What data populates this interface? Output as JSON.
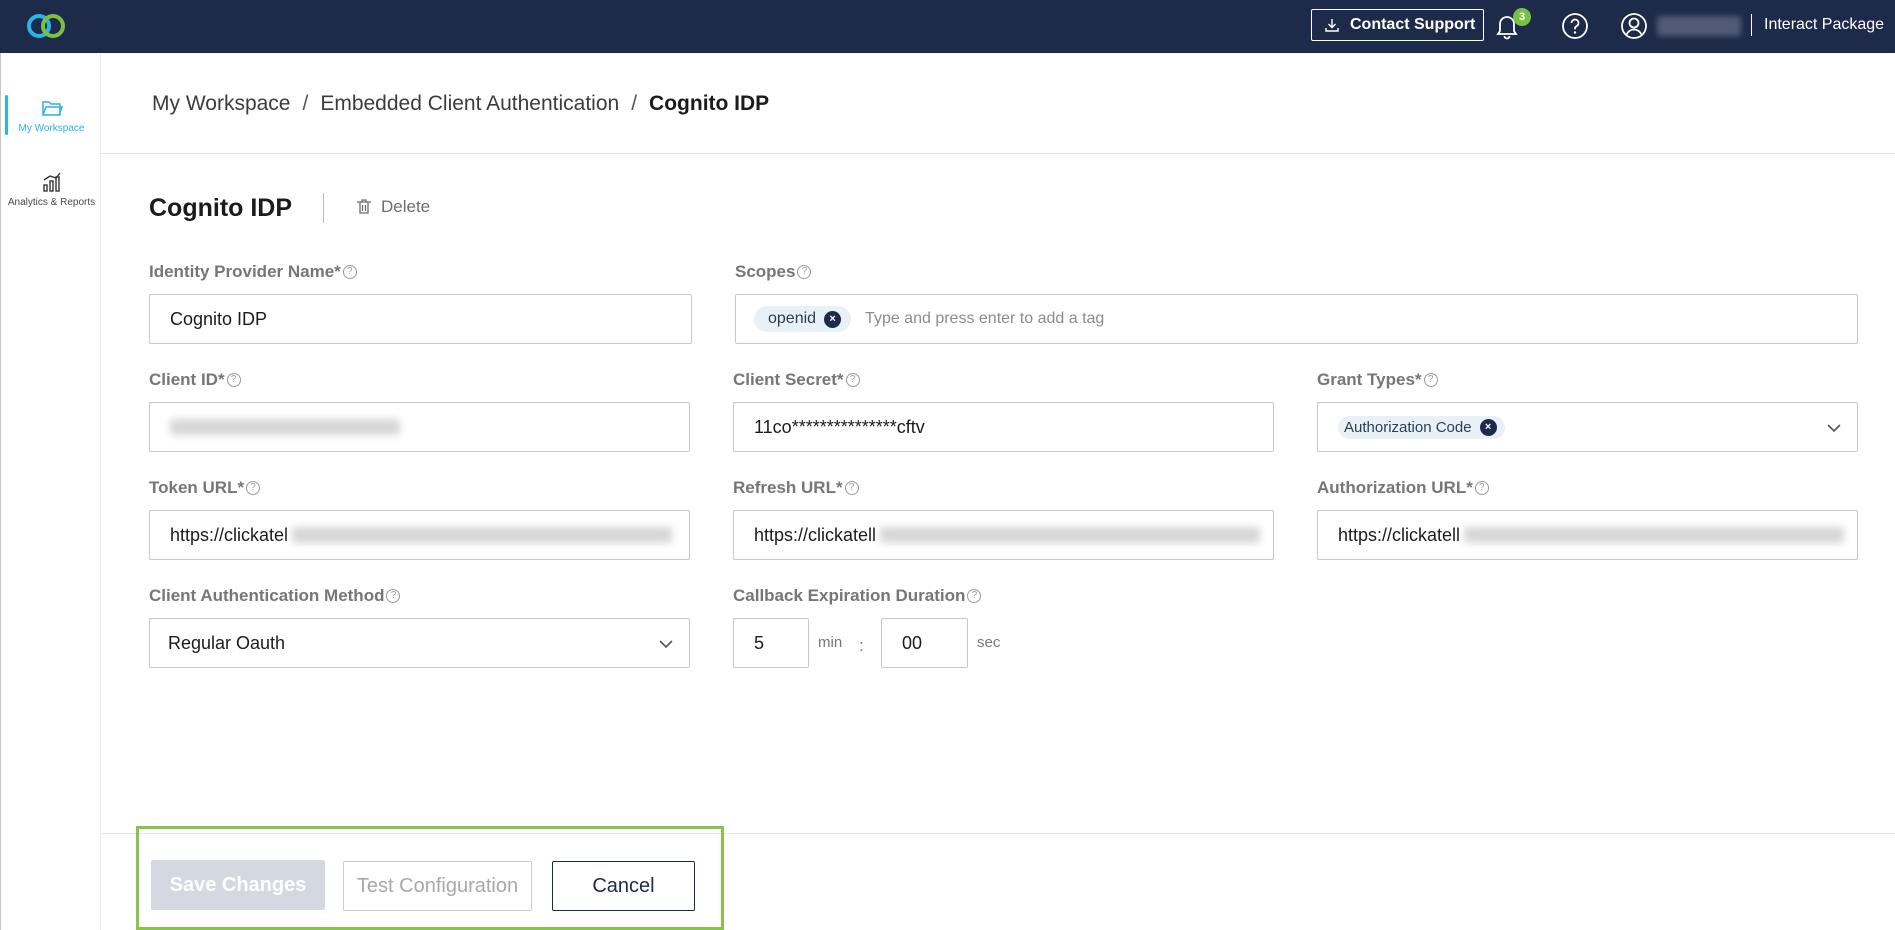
{
  "topbar": {
    "contact_support": "Contact Support",
    "notification_count": "3",
    "package": "Interact Package"
  },
  "nav": {
    "workspace": "My Workspace",
    "analytics": "Analytics & Reports"
  },
  "breadcrumb": {
    "items": [
      "My Workspace",
      "Embedded Client Authentication"
    ],
    "current": "Cognito IDP",
    "separator": "/"
  },
  "page": {
    "title": "Cognito IDP",
    "delete_label": "Delete"
  },
  "form": {
    "idp_name": {
      "label": "Identity Provider Name*",
      "value": "Cognito IDP"
    },
    "scopes": {
      "label": "Scopes",
      "tags": [
        "openid"
      ],
      "placeholder": "Type and press enter to add a tag"
    },
    "client_id": {
      "label": "Client ID*"
    },
    "client_secret": {
      "label": "Client Secret*",
      "value": "11co***************cftv"
    },
    "grant_types": {
      "label": "Grant Types*",
      "tags": [
        "Authorization Code"
      ]
    },
    "token_url": {
      "label": "Token URL*",
      "value": "https://clickatel"
    },
    "refresh_url": {
      "label": "Refresh URL*",
      "value": "https://clickatell"
    },
    "authorization_url": {
      "label": "Authorization URL*",
      "value": "https://clickatell"
    },
    "client_auth_method": {
      "label": "Client Authentication Method",
      "value": "Regular Oauth"
    },
    "callback_expiration": {
      "label": "Callback Expiration Duration",
      "minutes": "5",
      "minutes_unit": "min",
      "seconds": "00",
      "seconds_unit": "sec",
      "separator": ":"
    }
  },
  "footer": {
    "save": "Save Changes",
    "test": "Test Configuration",
    "cancel": "Cancel"
  },
  "colors": {
    "topbar": "#1e2a4a",
    "accent": "#2bb4e6",
    "badge": "#7ac143",
    "highlight_box": "#8bc34a"
  }
}
